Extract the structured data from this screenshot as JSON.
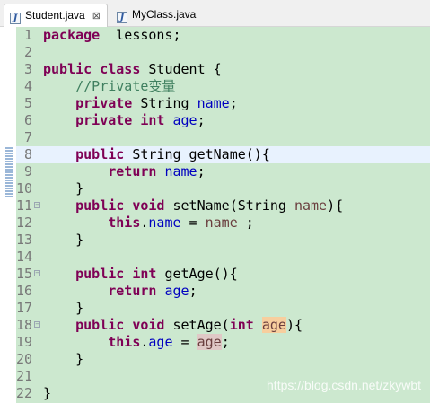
{
  "tabs": [
    {
      "label": "Student.java",
      "active": true,
      "close": "⊠"
    },
    {
      "label": "MyClass.java",
      "active": false
    }
  ],
  "colors": {
    "editor_bg": "#cce8cf",
    "keyword": "#7f0055",
    "field": "#0000c0",
    "comment": "#3f7f5f",
    "parameter": "#6a3e3e",
    "current_line": "#e8f2fe"
  },
  "current_line": 8,
  "lines": [
    {
      "n": "1",
      "fold": false,
      "parts": [
        [
          "kw",
          "package"
        ],
        [
          "",
          "  lessons;"
        ]
      ]
    },
    {
      "n": "2",
      "fold": false,
      "parts": []
    },
    {
      "n": "3",
      "fold": false,
      "parts": [
        [
          "kw",
          "public"
        ],
        [
          "",
          " "
        ],
        [
          "kw",
          "class"
        ],
        [
          "",
          " Student {"
        ]
      ]
    },
    {
      "n": "4",
      "fold": false,
      "parts": [
        [
          "",
          "    "
        ],
        [
          "cmt",
          "//Private变量"
        ]
      ]
    },
    {
      "n": "5",
      "fold": false,
      "parts": [
        [
          "",
          "    "
        ],
        [
          "kw",
          "private"
        ],
        [
          "",
          " String "
        ],
        [
          "fld",
          "name"
        ],
        [
          "",
          ";"
        ]
      ]
    },
    {
      "n": "6",
      "fold": false,
      "parts": [
        [
          "",
          "    "
        ],
        [
          "kw",
          "private"
        ],
        [
          "",
          " "
        ],
        [
          "kw",
          "int"
        ],
        [
          "",
          " "
        ],
        [
          "fld",
          "age"
        ],
        [
          "",
          ";"
        ]
      ]
    },
    {
      "n": "7",
      "fold": false,
      "parts": []
    },
    {
      "n": "8",
      "fold": false,
      "parts": [
        [
          "",
          "    "
        ],
        [
          "kw",
          "public"
        ],
        [
          "",
          " String getName(){"
        ]
      ]
    },
    {
      "n": "9",
      "fold": false,
      "parts": [
        [
          "",
          "        "
        ],
        [
          "kw",
          "return"
        ],
        [
          "",
          " "
        ],
        [
          "fld",
          "name"
        ],
        [
          "",
          ";"
        ]
      ]
    },
    {
      "n": "10",
      "fold": false,
      "parts": [
        [
          "",
          "    }"
        ]
      ]
    },
    {
      "n": "11",
      "fold": true,
      "parts": [
        [
          "",
          "    "
        ],
        [
          "kw",
          "public"
        ],
        [
          "",
          " "
        ],
        [
          "kw",
          "void"
        ],
        [
          "",
          " setName(String "
        ],
        [
          "prm",
          "name"
        ],
        [
          "",
          "){"
        ]
      ]
    },
    {
      "n": "12",
      "fold": false,
      "parts": [
        [
          "",
          "        "
        ],
        [
          "kw",
          "this"
        ],
        [
          "",
          "."
        ],
        [
          "fld",
          "name"
        ],
        [
          "",
          " = "
        ],
        [
          "prm",
          "name"
        ],
        [
          "",
          " ;"
        ]
      ]
    },
    {
      "n": "13",
      "fold": false,
      "parts": [
        [
          "",
          "    }"
        ]
      ]
    },
    {
      "n": "14",
      "fold": false,
      "parts": []
    },
    {
      "n": "15",
      "fold": true,
      "parts": [
        [
          "",
          "    "
        ],
        [
          "kw",
          "public"
        ],
        [
          "",
          " "
        ],
        [
          "kw",
          "int"
        ],
        [
          "",
          " getAge(){"
        ]
      ]
    },
    {
      "n": "16",
      "fold": false,
      "parts": [
        [
          "",
          "        "
        ],
        [
          "kw",
          "return"
        ],
        [
          "",
          " "
        ],
        [
          "fld",
          "age"
        ],
        [
          "",
          ";"
        ]
      ]
    },
    {
      "n": "17",
      "fold": false,
      "parts": [
        [
          "",
          "    }"
        ]
      ]
    },
    {
      "n": "18",
      "fold": true,
      "parts": [
        [
          "",
          "    "
        ],
        [
          "kw",
          "public"
        ],
        [
          "",
          " "
        ],
        [
          "kw",
          "void"
        ],
        [
          "",
          " setAge("
        ],
        [
          "kw",
          "int"
        ],
        [
          "",
          " "
        ],
        [
          "prm hl-occ",
          "age"
        ],
        [
          "",
          "){"
        ]
      ]
    },
    {
      "n": "19",
      "fold": false,
      "parts": [
        [
          "",
          "        "
        ],
        [
          "kw",
          "this"
        ],
        [
          "",
          "."
        ],
        [
          "fld",
          "age"
        ],
        [
          "",
          " = "
        ],
        [
          "prm hl-read",
          "age"
        ],
        [
          "",
          ";"
        ]
      ]
    },
    {
      "n": "20",
      "fold": false,
      "parts": [
        [
          "",
          "    }"
        ]
      ]
    },
    {
      "n": "21",
      "fold": false,
      "parts": []
    },
    {
      "n": "22",
      "fold": false,
      "parts": [
        [
          "",
          "}"
        ]
      ]
    }
  ],
  "watermark": "https://blog.csdn.net/zkywbt"
}
